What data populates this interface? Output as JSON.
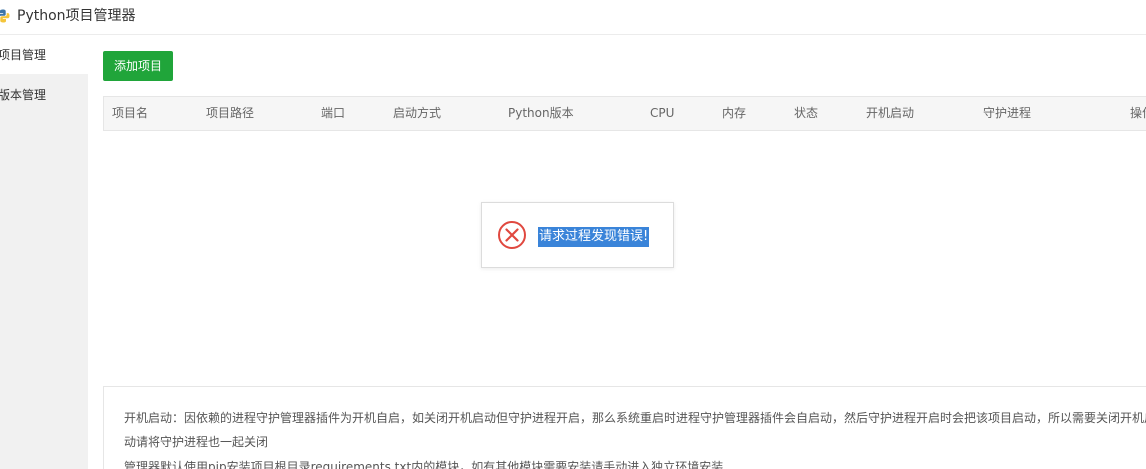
{
  "app": {
    "title": "Python项目管理器",
    "logo_icon": "python-logo-icon"
  },
  "sidebar": {
    "items": [
      {
        "label": "项目管理",
        "active": true
      },
      {
        "label": "版本管理",
        "active": false
      }
    ]
  },
  "toolbar": {
    "add_label": "添加项目",
    "add_color": "#20a53a"
  },
  "table": {
    "columns": [
      "项目名",
      "项目路径",
      "端口",
      "启动方式",
      "Python版本",
      "CPU",
      "内存",
      "状态",
      "开机启动",
      "守护进程",
      "操作"
    ],
    "rows": []
  },
  "message": {
    "icon": "error-circle-icon",
    "text": "请求过程发现错误!",
    "icon_color": "#e0483f"
  },
  "notice": {
    "line1": "开机启动：因依赖的进程守护管理器插件为开机自启，如关闭开机启动但守护进程开启，那么系统重启时进程守护管理器插件会自启动，然后守护进程开启时会把该项目启动，所以需要关闭开机启",
    "line2": "动请将守护进程也一起关闭",
    "line3": "管理器默认使用pip安装项目根目录requirements.txt内的模块，如有其他模块需要安装请手动进入独立环境安装"
  }
}
